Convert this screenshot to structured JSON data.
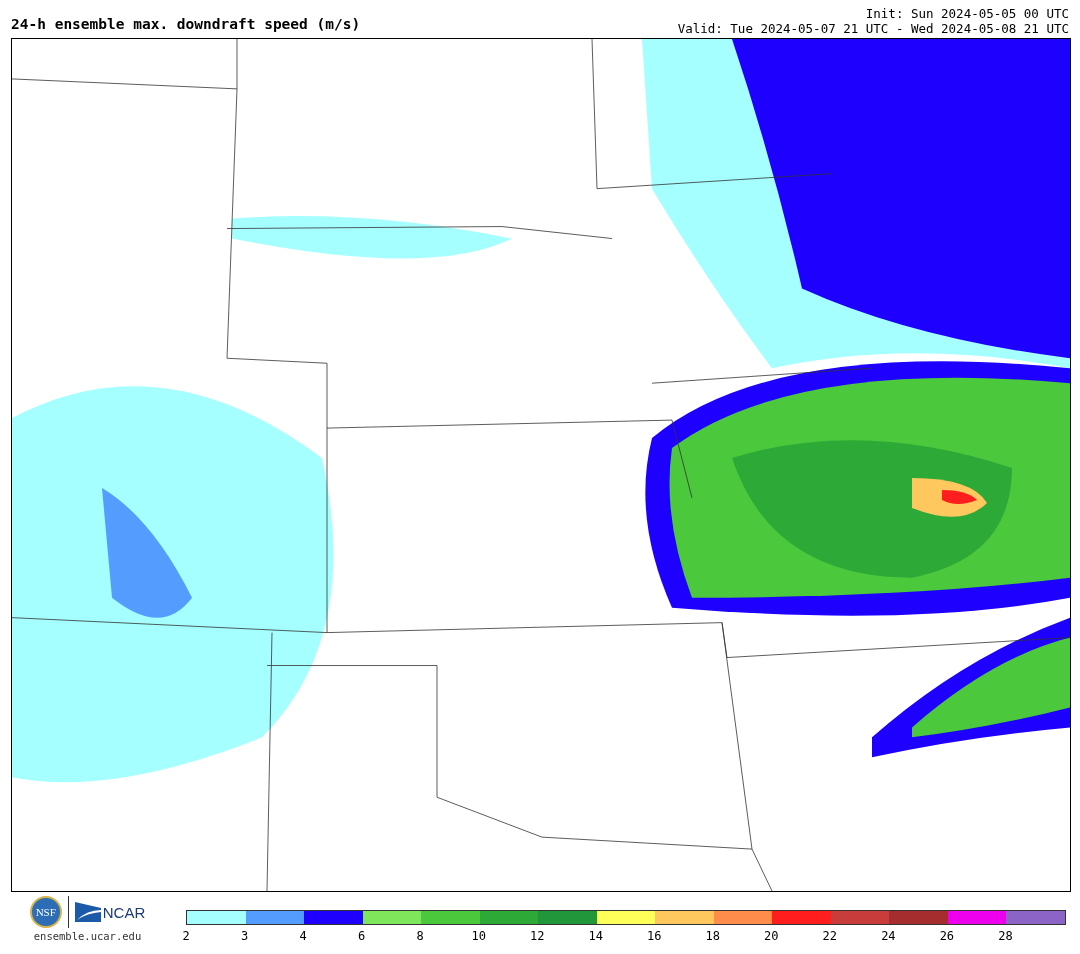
{
  "header": {
    "title": "24-h ensemble max. downdraft speed (m/s)",
    "init": "Init: Sun 2024-05-05 00 UTC",
    "valid": "Valid: Tue 2024-05-07 21 UTC - Wed 2024-05-08 21 UTC"
  },
  "footer": {
    "logo_left": "NSF",
    "logo_right": "NCAR",
    "url": "ensemble.ucar.edu"
  },
  "colorbar": {
    "segments": [
      {
        "color": "#a6ffff"
      },
      {
        "color": "#559cff"
      },
      {
        "color": "#1e00ff"
      },
      {
        "color": "#7de65a"
      },
      {
        "color": "#4bc83c"
      },
      {
        "color": "#2da937"
      },
      {
        "color": "#21963a"
      },
      {
        "color": "#ffff5a"
      },
      {
        "color": "#ffc85f"
      },
      {
        "color": "#ff8c4b"
      },
      {
        "color": "#ff1e1e"
      },
      {
        "color": "#c83c3c"
      },
      {
        "color": "#a52d2d"
      },
      {
        "color": "#ee00ee"
      },
      {
        "color": "#8c64c8"
      }
    ],
    "ticks": [
      "2",
      "3",
      "4",
      "6",
      "8",
      "10",
      "12",
      "14",
      "16",
      "18",
      "20",
      "22",
      "24",
      "26",
      "28"
    ]
  }
}
